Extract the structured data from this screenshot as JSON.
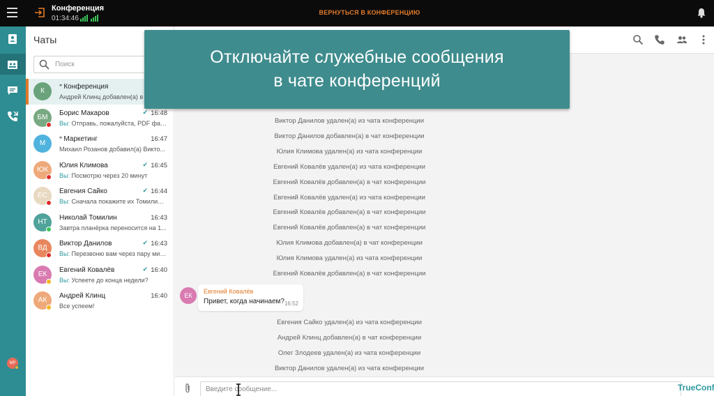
{
  "topbar": {
    "title": "Конференция",
    "timer": "01:34:46",
    "return_label": "ВЕРНУТЬСЯ В КОНФЕРЕНЦИЮ",
    "return_color": "#e07a2a"
  },
  "rail": {
    "icons": [
      "contacts-icon",
      "dashboard-icon",
      "chat-icon",
      "call-history-icon",
      "settings-icon"
    ],
    "active": "chat-icon",
    "user_initials": "МР",
    "accent": "#2e8d93"
  },
  "chats": {
    "title": "Чаты",
    "search_placeholder": "Поиск",
    "items": [
      {
        "name": "Конференция",
        "initials": "К",
        "avatar_color": "#6aa37b",
        "time": "",
        "preview_prefix": "",
        "preview": "Андрей Клинц добавлен(а) в ч",
        "group": true,
        "status": "",
        "active": true
      },
      {
        "name": "Борис Макаров",
        "initials": "БМ",
        "avatar_color": "#79a982",
        "time": "16:48",
        "preview_prefix": "Вы: ",
        "preview": "Отправь, пожалуйста, PDF файл...",
        "group": false,
        "status": "#e02a2a",
        "checked": true
      },
      {
        "name": "Маркетинг",
        "initials": "М",
        "avatar_color": "#4fb3de",
        "time": "16:47",
        "preview_prefix": "",
        "preview": "Михаил Розанов добавил(а) Викто...",
        "group": true,
        "status": ""
      },
      {
        "name": "Юлия Климова",
        "initials": "ЮК",
        "avatar_color": "#eea97a",
        "time": "16:45",
        "preview_prefix": "Вы: ",
        "preview": "Посмотрю через 20 минут",
        "group": false,
        "status": "#e02a2a",
        "checked": true
      },
      {
        "name": "Евгения Сайко",
        "initials": "ЕС",
        "avatar_color": "#e8d9c1",
        "time": "16:44",
        "preview_prefix": "Вы: ",
        "preview": "Сначала покажите их Томилину...",
        "group": false,
        "status": "#e02a2a",
        "checked": true
      },
      {
        "name": "Николай Томилин",
        "initials": "НТ",
        "avatar_color": "#4fa39b",
        "time": "16:43",
        "preview_prefix": "",
        "preview": "Завтра планёрка переносится на 1...",
        "group": false,
        "status": "#3cc45a"
      },
      {
        "name": "Виктор Данилов",
        "initials": "ВД",
        "avatar_color": "#e8865e",
        "time": "16:43",
        "preview_prefix": "Вы: ",
        "preview": "Перезвоню вам через пару мин...",
        "group": false,
        "status": "#e02a2a",
        "checked": true
      },
      {
        "name": "Евгений Ковалёв",
        "initials": "ЕК",
        "avatar_color": "#d97bb1",
        "time": "16:40",
        "preview_prefix": "Вы: ",
        "preview": "Успеете до конца недели?",
        "group": false,
        "status": "#f5b521",
        "checked": true
      },
      {
        "name": "Андрей Клинц",
        "initials": "АК",
        "avatar_color": "#eea97a",
        "time": "16:40",
        "preview_prefix": "",
        "preview": "Все успеем!",
        "group": false,
        "status": "#f5b521"
      }
    ]
  },
  "banner": {
    "line1": "Отключайте служебные сообщения",
    "line2": "в чате конференций",
    "color": "#3f8c8e"
  },
  "conversation": {
    "system_messages_top": [
      "Виктор Данилов удален(а) из чата конференции",
      "Виктор Данилов добавлен(а) в чат конференции",
      "Юлия Климова удален(а) из чата конференции",
      "Евгений Ковалёв удален(а) из чата конференции",
      "Евгений Ковалёв добавлен(а) в чат конференции",
      "Евгений Ковалёв удален(а) из чата конференции",
      "Евгений Ковалёв добавлен(а) в чат конференции",
      "Евгений Ковалёв добавлен(а) в чат конференции",
      "Юлия Климова добавлен(а) в чат конференции",
      "Юлия Климова удален(а) из чата конференции",
      "Евгений Ковалёв добавлен(а) в чат конференции"
    ],
    "message": {
      "author": "Евгений Ковалёв",
      "initials": "ЕК",
      "text": "Привет, когда начинаем?",
      "time": "16:52"
    },
    "system_messages_bottom": [
      "Евгения Сайко удален(а) из чата конференции",
      "Андрей Клинц добавлен(а) в чат конференции",
      "Олег Злодеев удален(а) из чата конференции",
      "Виктор Данилов удален(а) из чата конференции"
    ],
    "composer_placeholder": "Введите сообщение...",
    "brand": "TrueConf"
  }
}
